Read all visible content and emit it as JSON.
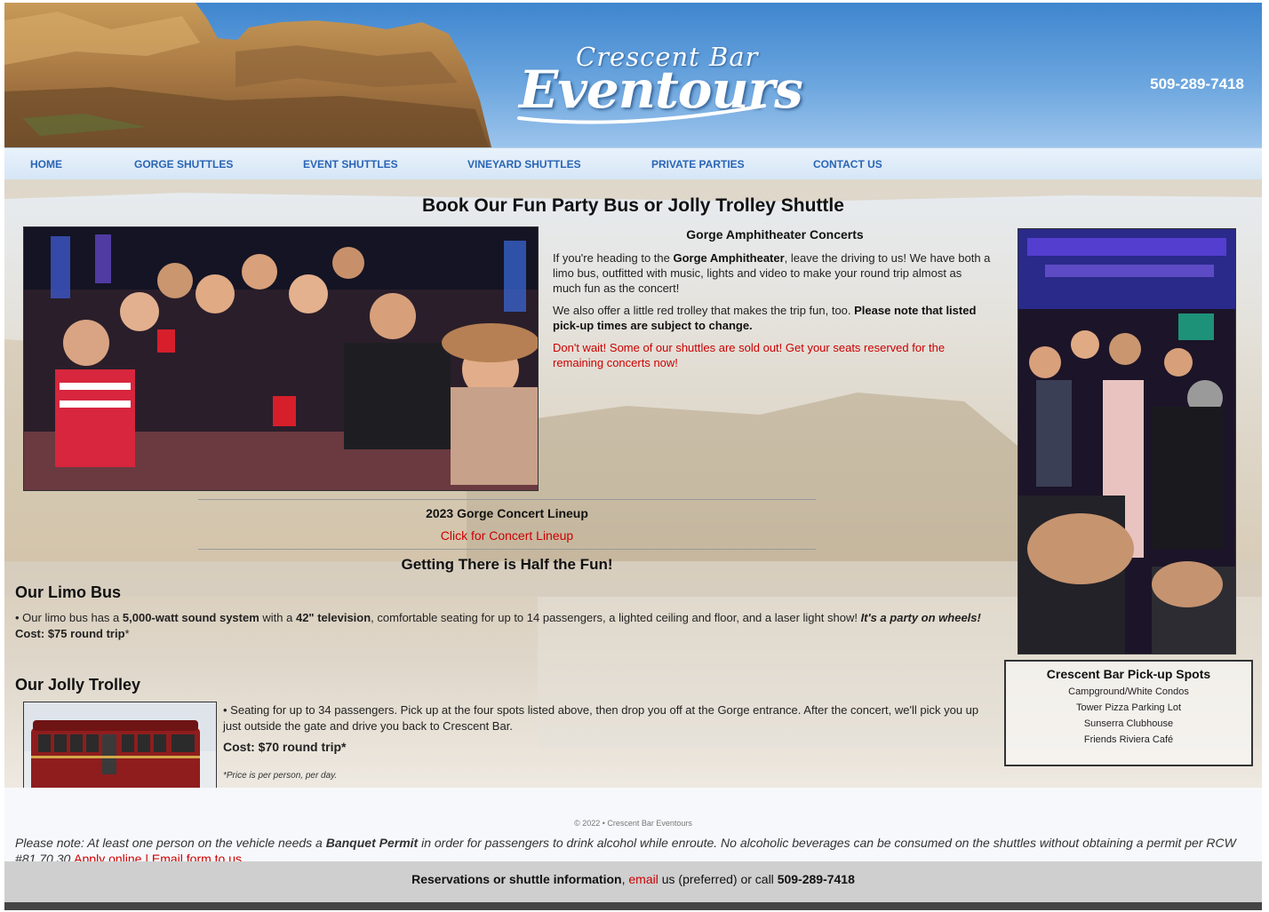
{
  "header": {
    "logo_top": "Crescent Bar",
    "logo_main": "Eventours",
    "phone": "509-289-7418"
  },
  "nav": [
    {
      "label": "HOME"
    },
    {
      "label": "GORGE SHUTTLES"
    },
    {
      "label": "EVENT SHUTTLES"
    },
    {
      "label": "VINEYARD SHUTTLES"
    },
    {
      "label": "PRIVATE PARTIES"
    },
    {
      "label": "CONTACT US"
    }
  ],
  "main": {
    "title": "Book Our Fun Party Bus or Jolly Trolley Shuttle",
    "concerts_heading": "Gorge Amphitheater Concerts",
    "p1_a": "If you're heading to the ",
    "p1_b": "Gorge Amphitheater",
    "p1_c": ", leave the driving to us! We have both a limo bus, outfitted with music, lights and video to make your round trip almost as much fun as the concert!",
    "p2_a": "We also offer a little red trolley that makes the trip fun, too. ",
    "p2_b": "Please note that listed pick-up times are subject to change.",
    "p3": "Don't wait! Some of our shuttles are sold out! Get your seats reserved for the remaining concerts now!",
    "lineup_heading": "2023 Gorge Concert Lineup",
    "lineup_link": "Click for Concert Lineup",
    "half_fun": "Getting There is Half the Fun!"
  },
  "limo": {
    "heading": "Our Limo Bus",
    "t1": "• Our limo bus has a ",
    "t2": "5,000-watt sound system",
    "t3": " with a ",
    "t4": "42\" television",
    "t5": ", comfortable seating for up to 14 passengers, a lighted ceiling and floor, and a laser light show! ",
    "t6": "It's a party on wheels!",
    "t7": " Cost: $75 round trip",
    "t8": "*"
  },
  "trolley": {
    "heading": "Our Jolly Trolley",
    "desc": "• Seating for up to 34 passengers. Pick up at the four spots listed above, then drop you off at the Gorge entrance. After the concert, we'll pick you up just outside the gate and drive you back to Crescent Bar.",
    "cost": "Cost: $70 round trip*",
    "price_note": "*Price is per person, per day."
  },
  "pickup": {
    "title": "Crescent Bar Pick-up Spots",
    "items": [
      "Campground/White Condos",
      "Tower Pizza Parking Lot",
      "Sunserra Clubhouse",
      "Friends Riviera Café"
    ]
  },
  "footer": {
    "copyright": "© 2022 • Crescent Bar Eventours",
    "note_a": "Please note: At least one person on the vehicle needs a ",
    "note_b": "Banquet Permit",
    "note_c": " in order for passengers to drink alcohol while enroute. No alcoholic beverages can be consumed on the shuttles without obtaining a permit per RCW #81.70.30 ",
    "apply": "Apply online",
    "sep": " | ",
    "email_form": "Email form to us",
    "res_a": "Reservations or shuttle information",
    "res_b": ", ",
    "res_email": "email",
    "res_c": " us (preferred) or call ",
    "res_phone": "509-289-7418"
  },
  "colors": {
    "accent_red": "#cc0000",
    "nav_blue": "#2a65b5",
    "header_sky": "#4a8fd6"
  }
}
